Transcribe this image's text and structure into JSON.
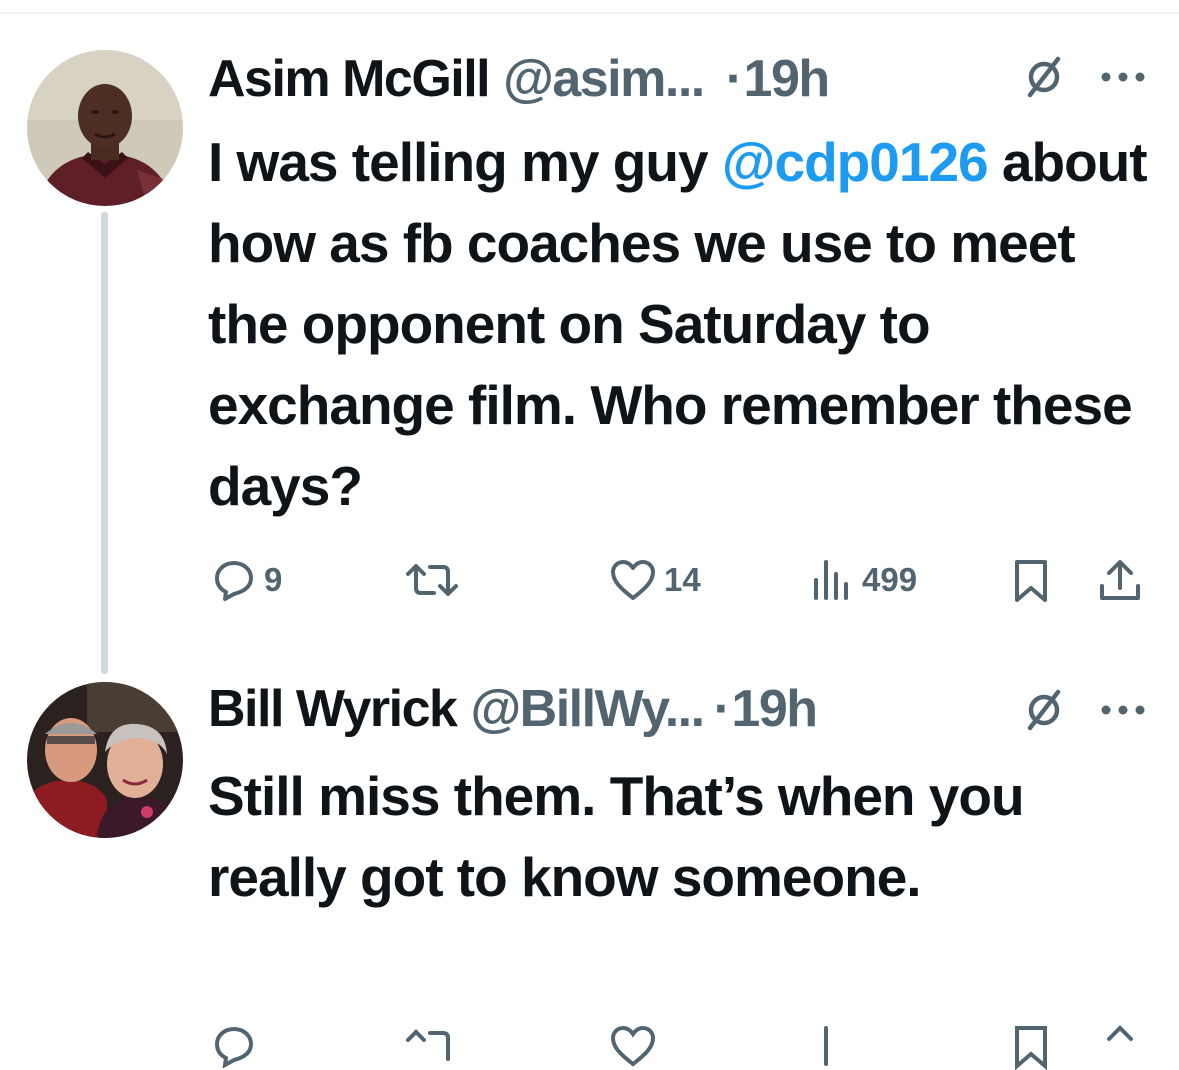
{
  "tweets": [
    {
      "name": "Asim McGill",
      "handle": "@asim...",
      "dot": "·",
      "time": "19h",
      "text_before": "I was telling my guy ",
      "mention": "@cdp0126",
      "text_after": " about how as fb coaches we use to meet the opponent on Saturday to exchange film. Who remember these days?",
      "replies": "9",
      "retweets": "",
      "likes": "14",
      "views": "499"
    },
    {
      "name": "Bill Wyrick",
      "handle": "@BillWy...",
      "dot": "·",
      "time": "19h",
      "text": "Still miss them. That’s when you really got to know someone."
    }
  ],
  "icons": {
    "reply": "reply-icon",
    "retweet": "retweet-icon",
    "like": "heart-icon",
    "views": "views-icon",
    "bookmark": "bookmark-icon",
    "share": "share-icon",
    "grok": "grok-icon",
    "more": "more-icon"
  },
  "colors": {
    "text": "#0f1419",
    "secondary": "#536471",
    "link": "#1d9bf0",
    "thread_line": "#cfd9de"
  }
}
